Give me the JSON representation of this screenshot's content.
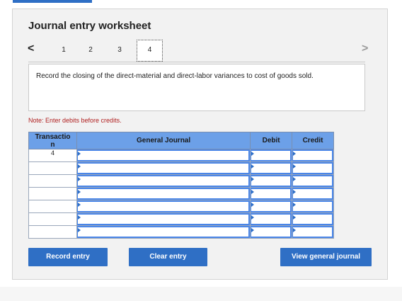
{
  "worksheet": {
    "title": "Journal entry worksheet",
    "prev_icon": "chevron-left-icon",
    "next_icon": "chevron-right-icon",
    "steps": [
      "1",
      "2",
      "3",
      "4"
    ],
    "active_step": "4",
    "instruction": "Record the closing of the direct-material and direct-labor variances to cost of goods sold.",
    "note": "Note: Enter debits before credits."
  },
  "table": {
    "headers": {
      "transaction": "Transaction",
      "general_journal": "General Journal",
      "debit": "Debit",
      "credit": "Credit"
    },
    "rows": [
      {
        "transaction": "4",
        "account": "",
        "debit": "",
        "credit": ""
      },
      {
        "transaction": "",
        "account": "",
        "debit": "",
        "credit": ""
      },
      {
        "transaction": "",
        "account": "",
        "debit": "",
        "credit": ""
      },
      {
        "transaction": "",
        "account": "",
        "debit": "",
        "credit": ""
      },
      {
        "transaction": "",
        "account": "",
        "debit": "",
        "credit": ""
      },
      {
        "transaction": "",
        "account": "",
        "debit": "",
        "credit": ""
      },
      {
        "transaction": "",
        "account": "",
        "debit": "",
        "credit": ""
      }
    ]
  },
  "buttons": {
    "record": "Record entry",
    "clear": "Clear entry",
    "view": "View general journal"
  },
  "colors": {
    "accent": "#2f6fc5",
    "header_bg": "#6ca0e8",
    "note": "#b02020"
  }
}
